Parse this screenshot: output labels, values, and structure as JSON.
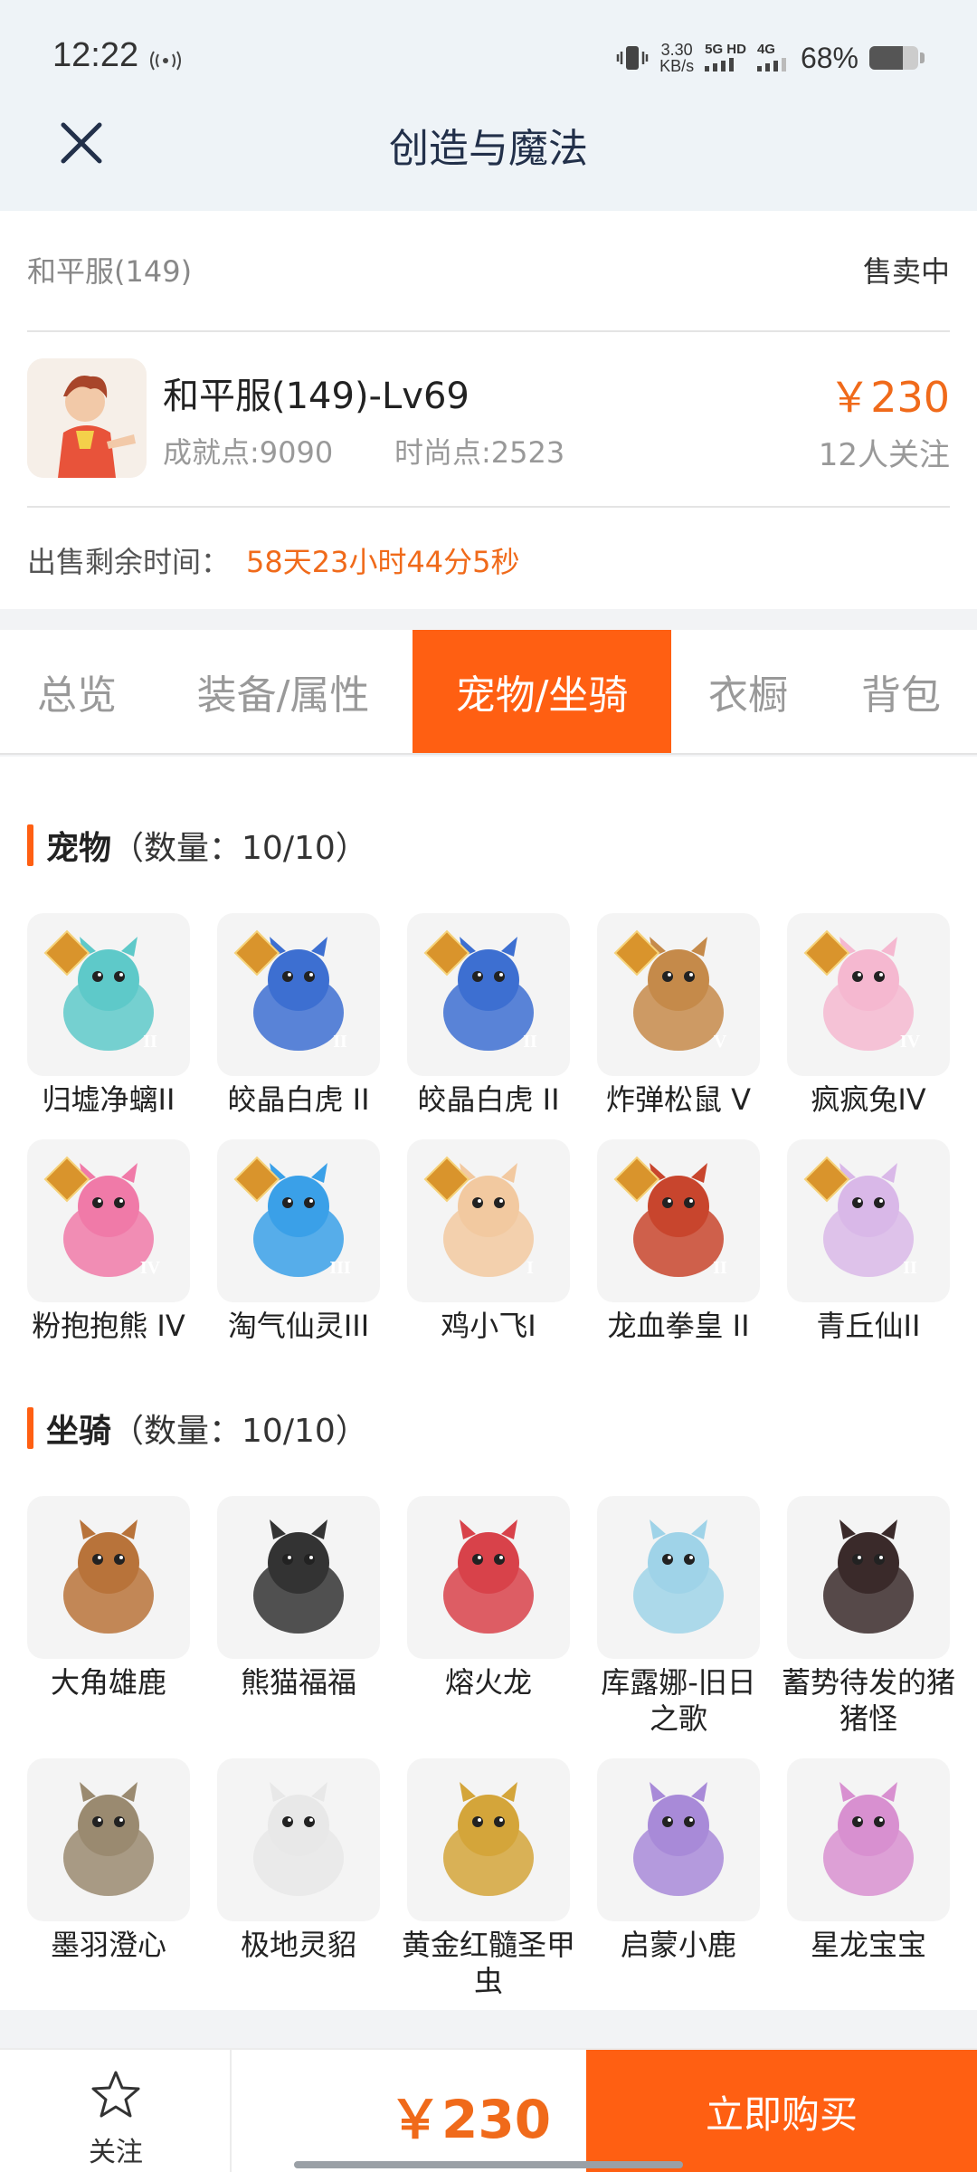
{
  "status_bar": {
    "time": "12:22",
    "net_speed_value": "3.30",
    "net_speed_unit": "KB/s",
    "net_type_1": "5G HD",
    "net_type_2": "4G",
    "battery": "68%",
    "battery_level": 0.68
  },
  "header": {
    "title": "创造与魔法",
    "close_icon": "close-icon"
  },
  "listing": {
    "server": "和平服(149)",
    "status": "售卖中",
    "character_name": "和平服(149)-Lv69",
    "achievement": "成就点:9090",
    "fashion": "时尚点:2523",
    "price": "￥230",
    "followers": "12人关注",
    "timer_label": "出售剩余时间：",
    "timer_value": "58天23小时44分5秒"
  },
  "tabs": [
    "总览",
    "装备/属性",
    "宠物/坐骑",
    "衣橱",
    "背包"
  ],
  "active_tab": 2,
  "pets": {
    "title": "宠物",
    "count": "（数量：10/10）",
    "items": [
      {
        "label": "归墟净螭II",
        "rank": "II",
        "color": "#5ec9c9"
      },
      {
        "label": "皎晶白虎 II",
        "rank": "II",
        "color": "#3d6fd1"
      },
      {
        "label": "皎晶白虎 II",
        "rank": "II",
        "color": "#3d6fd1"
      },
      {
        "label": "炸弹松鼠 V",
        "rank": "V",
        "color": "#c58a4a"
      },
      {
        "label": "疯疯兔IV",
        "rank": "IV",
        "color": "#f5b8d0"
      },
      {
        "label": "粉抱抱熊 IV",
        "rank": "IV",
        "color": "#f07aa8"
      },
      {
        "label": "淘气仙灵III",
        "rank": "III",
        "color": "#3aa0e8"
      },
      {
        "label": "鸡小飞I",
        "rank": "I",
        "color": "#f2c9a0"
      },
      {
        "label": "龙血拳皇 II",
        "rank": "II",
        "color": "#c8452d"
      },
      {
        "label": "青丘仙II",
        "rank": "II",
        "color": "#d9b8e8"
      }
    ]
  },
  "mounts": {
    "title": "坐骑",
    "count": "（数量：10/10）",
    "items": [
      {
        "label": "大角雄鹿",
        "color": "#b8733a"
      },
      {
        "label": "熊猫福福",
        "color": "#333333"
      },
      {
        "label": "熔火龙",
        "color": "#d8424a"
      },
      {
        "label": "库露娜-旧日之歌",
        "color": "#9fd3e8"
      },
      {
        "label": "蓄势待发的猪猪怪",
        "color": "#3a2a2a"
      },
      {
        "label": "墨羽澄心",
        "color": "#9a8a70"
      },
      {
        "label": "极地灵貂",
        "color": "#e8e8e8"
      },
      {
        "label": "黄金红髓圣甲虫",
        "color": "#d4a53a"
      },
      {
        "label": "启蒙小鹿",
        "color": "#a88ad8"
      },
      {
        "label": "星龙宝宝",
        "color": "#d890d0"
      }
    ]
  },
  "bottom_bar": {
    "follow_label": "关注",
    "follow_icon": "star-icon",
    "price": "￥230",
    "buy_label": "立即购买"
  },
  "colors": {
    "accent": "#ff5f12",
    "price": "#f06a1a",
    "header_bg": "#eef3f7"
  }
}
